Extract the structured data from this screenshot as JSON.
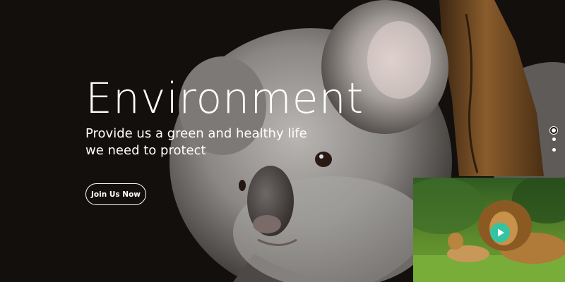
{
  "hero": {
    "title": "Environment",
    "subtitle_line1": "Provide us a green and healthy life",
    "subtitle_line2": "we need to protect",
    "cta_label": "Join Us Now",
    "background_image": "koala-photo",
    "slides": {
      "count": 3,
      "active": 1
    }
  },
  "video": {
    "thumbnail": "lion-and-cub-photo",
    "play_icon": "play-icon",
    "accent_color": "#35c4a2"
  }
}
